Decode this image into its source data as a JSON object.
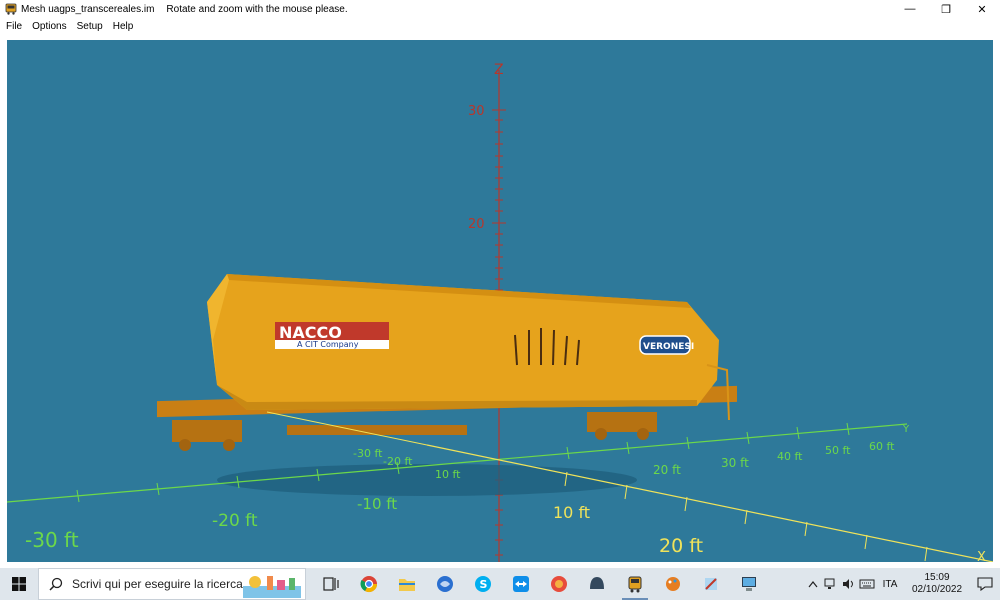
{
  "window": {
    "title": "Mesh uagps_transcereales.im",
    "hint": "Rotate and zoom with the mouse please.",
    "minimize_glyph": "—",
    "restore_glyph": "❐",
    "close_glyph": "✕"
  },
  "menu": {
    "items": [
      "File",
      "Options",
      "Setup",
      "Help"
    ]
  },
  "viewport": {
    "background": "#2e799a",
    "z_axis": {
      "label": "Z",
      "ticks": [
        "30",
        "20"
      ]
    },
    "y_axis": {
      "label": "Y",
      "ticks": [
        "-30 ft",
        "-20 ft",
        "10 ft",
        "20 ft",
        "30 ft",
        "40 ft",
        "50 ft",
        "60 ft"
      ]
    },
    "x_axis": {
      "label": "X",
      "ticks_left": [
        "-30 ft",
        "-20 ft",
        "-10 ft"
      ],
      "ticks_right": [
        "10 ft",
        "20 ft"
      ]
    },
    "wagon": {
      "brand": "NACCO",
      "brand_sub": "A CIT Company",
      "logo_text": "VERONESI",
      "body_color": "#e6a31c"
    }
  },
  "taskbar": {
    "search_placeholder": "Scrivi qui per eseguire la ricerca",
    "language": "ITA",
    "time": "15:09",
    "date": "02/10/2022"
  }
}
